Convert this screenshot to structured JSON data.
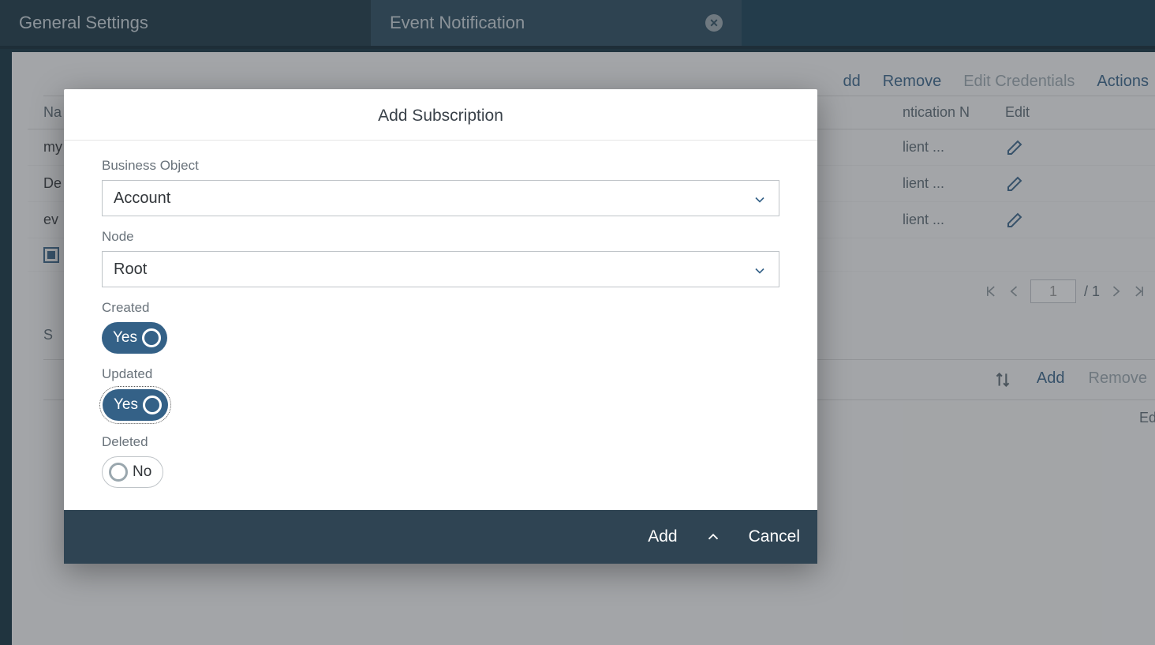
{
  "tabs": {
    "general_settings": "General Settings",
    "event_notification": "Event Notification"
  },
  "table_toolbar": {
    "add_partial": "dd",
    "remove": "Remove",
    "edit_credentials": "Edit Credentials",
    "actions": "Actions"
  },
  "table_headers": {
    "name_partial": "Na",
    "auth_partial": "ntication N",
    "edit": "Edit"
  },
  "rows_partial": {
    "r1_name": "my",
    "r1_auth": "lient ...",
    "r2_name": "De",
    "r2_auth": "lient ...",
    "r3_name": "ev",
    "r3_auth": "lient ..."
  },
  "pagination": {
    "current": "1",
    "total": "/ 1"
  },
  "subsection_toolbar": {
    "add": "Add",
    "remove": "Remove"
  },
  "subsection_left": "S",
  "subsection_headers": {
    "edit": "Edit"
  },
  "modal": {
    "title": "Add Subscription",
    "business_object_label": "Business Object",
    "business_object_value": "Account",
    "node_label": "Node",
    "node_value": "Root",
    "created_label": "Created",
    "created_state": "Yes",
    "updated_label": "Updated",
    "updated_state": "Yes",
    "deleted_label": "Deleted",
    "deleted_state": "No",
    "footer": {
      "add": "Add",
      "cancel": "Cancel"
    }
  }
}
